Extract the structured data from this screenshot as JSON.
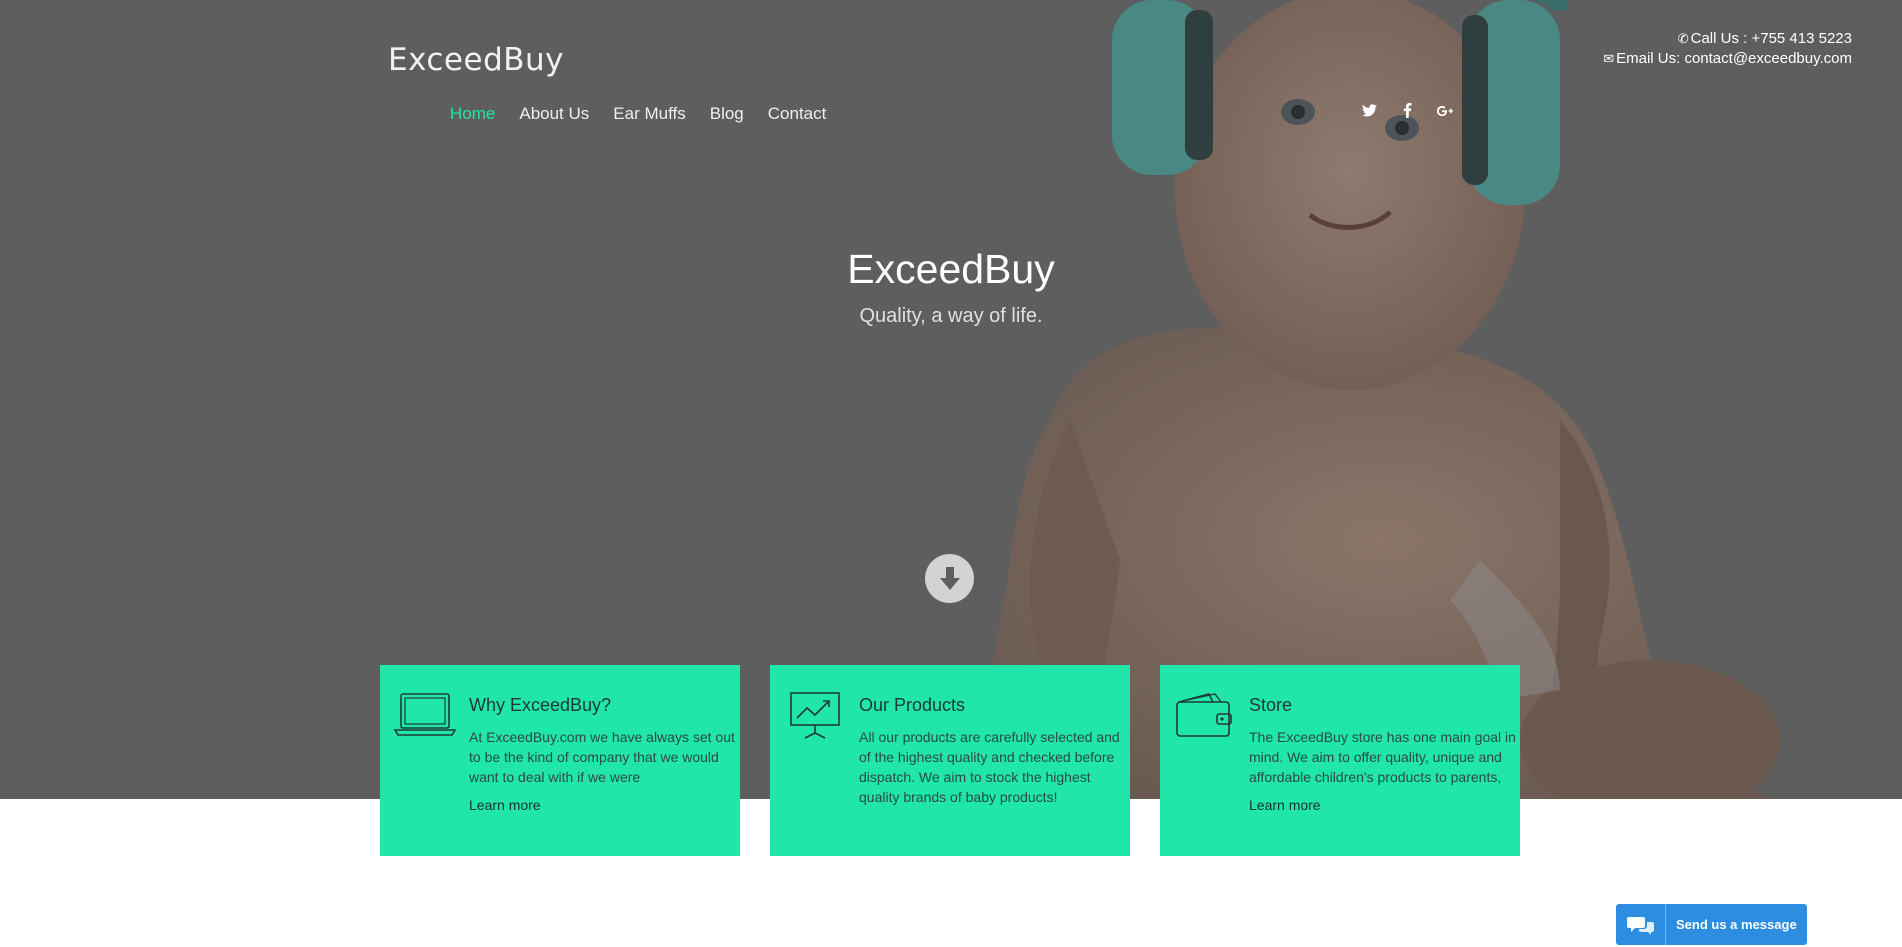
{
  "brand": {
    "logo_text": "ExceedBuy"
  },
  "nav": {
    "items": [
      {
        "label": "Home",
        "active": true
      },
      {
        "label": "About Us",
        "active": false
      },
      {
        "label": "Ear Muffs",
        "active": false
      },
      {
        "label": "Blog",
        "active": false
      },
      {
        "label": "Contact",
        "active": false
      }
    ]
  },
  "social": {
    "icons": [
      "twitter-icon",
      "facebook-icon",
      "google-plus-icon"
    ]
  },
  "contact": {
    "phone": "Call Us : +755 413 5223",
    "email": "Email Us: contact@exceedbuy.com"
  },
  "hero": {
    "title": "ExceedBuy",
    "subtitle": "Quality, a way of life."
  },
  "cards": [
    {
      "icon": "laptop-icon",
      "title": "Why ExceedBuy?",
      "text": "At ExceedBuy.com we have always set out to be the kind of company that we would want to deal with if we were",
      "link": "Learn more"
    },
    {
      "icon": "presentation-chart-icon",
      "title": "Our Products",
      "text": "All our products are carefully selected and of the highest quality and checked before dispatch. We aim to stock the highest quality brands of baby products!",
      "link": ""
    },
    {
      "icon": "wallet-icon",
      "title": "Store",
      "text": "The ExceedBuy store has one main goal in mind. We aim to offer quality, unique and affordable children's products to parents,",
      "link": "Learn more"
    }
  ],
  "chat": {
    "label": "Send us a message"
  },
  "colors": {
    "accent": "#22e3a7",
    "card_bg": "#21e6a9",
    "hero_overlay": "#5e5e5e",
    "chat_button": "#2d8de0"
  }
}
